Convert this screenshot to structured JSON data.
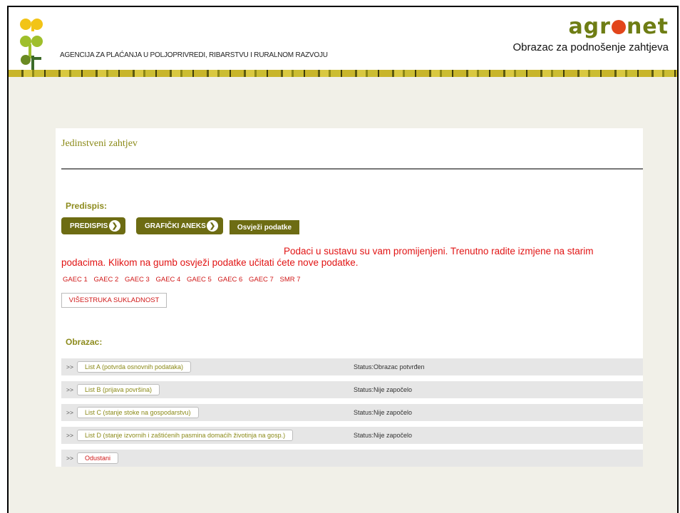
{
  "header": {
    "agency_name": "AGENCIJA ZA PLAĆANJA U POLJOPRIVREDI, RIBARSTVU I RURALNOM RAZVOJU",
    "brand_left": "agr",
    "brand_right": "net",
    "subtitle": "Obrazac za podnošenje zahtjeva"
  },
  "panel": {
    "title": "Jedinstveni zahtjev",
    "predispis_label": "Predispis:",
    "predispis_button": "PREDISPIS",
    "graficki_button": "GRAFIČKI ANEKS",
    "refresh_button": "Osvježi podatke",
    "warning_line1": "Podaci u sustavu su vam promijenjeni. Trenutno radite izmjene na starim",
    "warning_line2": "podacima. Klikom na gumb osvježi podatke učitati ćete nove podatke.",
    "gaec_links": [
      "GAEC 1",
      "GAEC 2",
      "GAEC 3",
      "GAEC 4",
      "GAEC 5",
      "GAEC 6",
      "GAEC 7",
      "SMR 7"
    ],
    "compliance_button": "VIŠESTRUKA SUKLADNOST",
    "obrazac_label": "Obrazac:",
    "forms": [
      {
        "arrow": ">>",
        "label": "List A (potvrda osnovnih podataka)",
        "status": "Status:Obrazac potvrđen"
      },
      {
        "arrow": ">>",
        "label": "List B (prijava površina)",
        "status": "Status:Nije započelo"
      },
      {
        "arrow": ">>",
        "label": "List C (stanje stoke na gospodarstvu)",
        "status": "Status:Nije započelo"
      },
      {
        "arrow": ">>",
        "label": "List D (stanje izvornih i zaštićenih pasmina domaćih životinja na gosp.)",
        "status": "Status:Nije započelo"
      },
      {
        "arrow": ">>",
        "label": "Odustani",
        "status": ""
      }
    ]
  },
  "colors": {
    "accent": "#6d6c13",
    "title_olive": "#8b8a18",
    "warning_red": "#e11414",
    "brand_green": "#6e7d14"
  }
}
